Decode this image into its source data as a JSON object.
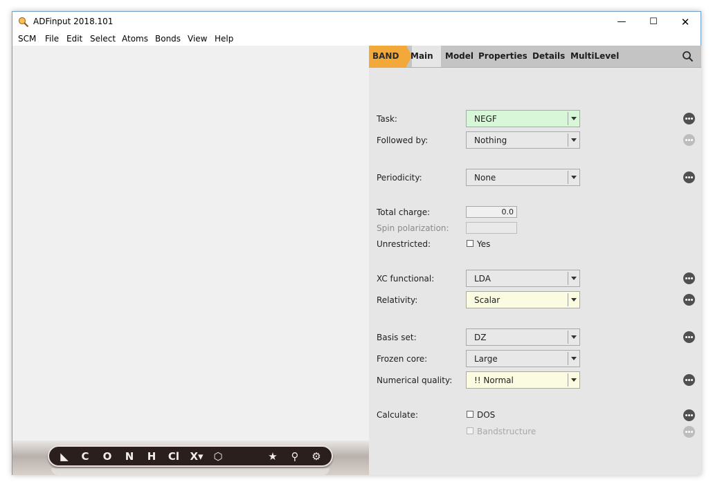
{
  "window": {
    "title": "ADFinput 2018.101",
    "minimize": "—",
    "maximize": "☐",
    "close": "✕"
  },
  "menu": [
    "SCM",
    "File",
    "Edit",
    "Select",
    "Atoms",
    "Bonds",
    "View",
    "Help"
  ],
  "toolbar": {
    "tools": [
      "◣",
      "C",
      "O",
      "N",
      "H",
      "Cl",
      "X▾",
      "⬡",
      "★",
      "⚲",
      "⚙"
    ]
  },
  "tabs": {
    "band": "BAND",
    "main": "Main",
    "model": "Model",
    "properties": "Properties",
    "details": "Details",
    "multilevel": "MultiLevel"
  },
  "form": {
    "task": {
      "label": "Task:",
      "value": "NEGF"
    },
    "followed_by": {
      "label": "Followed by:",
      "value": "Nothing"
    },
    "periodicity": {
      "label": "Periodicity:",
      "value": "None"
    },
    "total_charge": {
      "label": "Total charge:",
      "value": "0.0"
    },
    "spin_polarization": {
      "label": "Spin polarization:",
      "value": ""
    },
    "unrestricted": {
      "label": "Unrestricted:",
      "option": "Yes"
    },
    "xc_functional": {
      "label": "XC functional:",
      "value": "LDA"
    },
    "relativity": {
      "label": "Relativity:",
      "value": "Scalar"
    },
    "basis_set": {
      "label": "Basis set:",
      "value": "DZ"
    },
    "frozen_core": {
      "label": "Frozen core:",
      "value": "Large"
    },
    "numerical_quality": {
      "label": "Numerical quality:",
      "value": "!! Normal"
    },
    "calculate": {
      "label": "Calculate:",
      "dos": "DOS",
      "bandstructure": "Bandstructure"
    }
  },
  "colors": {
    "band_tab": "#f3a83a",
    "task_bg": "#d8f7d8",
    "warning_bg": "#fbfbe1",
    "panel_bg": "#e6e6e6"
  }
}
